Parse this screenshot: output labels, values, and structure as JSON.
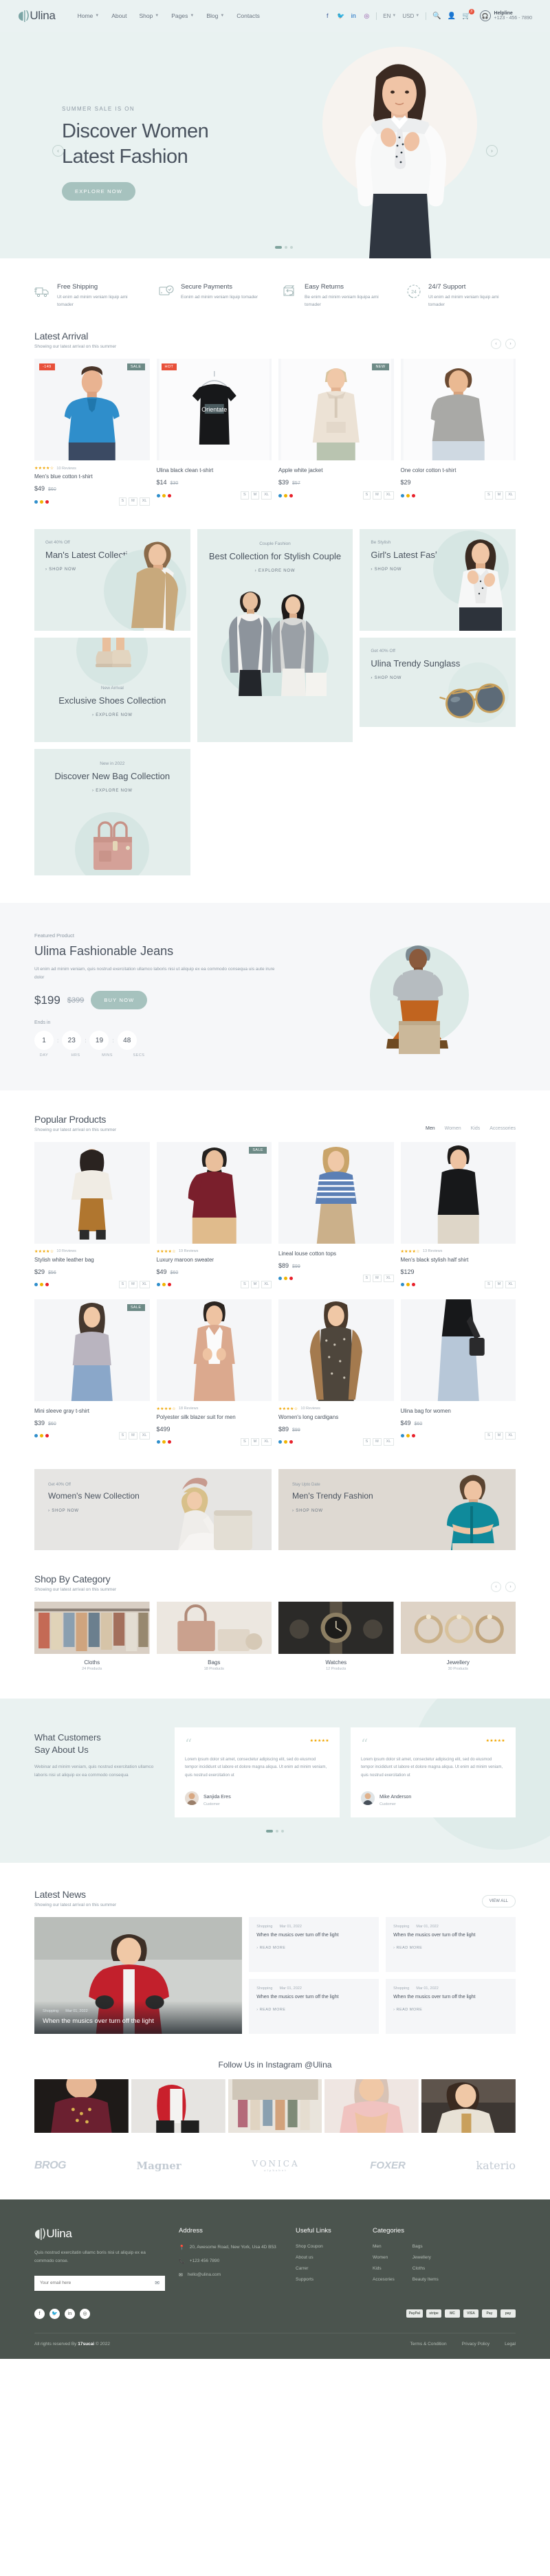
{
  "header": {
    "brand": "Ulina",
    "nav": [
      {
        "label": "Home",
        "caret": true
      },
      {
        "label": "About",
        "caret": false
      },
      {
        "label": "Shop",
        "caret": true
      },
      {
        "label": "Pages",
        "caret": true
      },
      {
        "label": "Blog",
        "caret": true
      },
      {
        "label": "Contacts",
        "caret": false
      }
    ],
    "social": [
      "facebook-icon",
      "twitter-icon",
      "linkedin-icon",
      "instagram-icon"
    ],
    "language": "EN",
    "currency": "USD",
    "cart_count": "3",
    "helpline_label": "Helpline",
    "helpline_number": "+123 - 456 - 7890"
  },
  "hero": {
    "kicker": "SUMMER SALE IS ON",
    "title_line1": "Discover Women",
    "title_line2": "Latest Fashion",
    "cta": "EXPLORE NOW",
    "prev": "‹",
    "next": "›"
  },
  "features": [
    {
      "icon": "truck-icon",
      "title": "Free Shipping",
      "desc": "Ut enim ad minim veniam liquip ami tomader"
    },
    {
      "icon": "shield-check-icon",
      "title": "Secure Payments",
      "desc": "Eonim ad minim veniam liquip tomader"
    },
    {
      "icon": "return-box-icon",
      "title": "Easy Returns",
      "desc": "Be enim ad minim veniam liquipa ami tomader"
    },
    {
      "icon": "support-24-icon",
      "title": "24/7 Support",
      "desc": "Ut enim ad minim veniam liquip ami tomader"
    }
  ],
  "latest_arrival": {
    "title": "Latest Arrival",
    "subtitle": "Showing our latest arrival on this summer",
    "products": [
      {
        "name": "Men's blue cotton t-shirt",
        "price": "$49",
        "old": "$60",
        "rating": "★★★★☆",
        "reviews": "10 Reviews",
        "badge_left": "-149",
        "badge_right": "SALE",
        "sizes": [
          "S",
          "M",
          "XL"
        ]
      },
      {
        "name": "Ulina black clean t-shirt",
        "price": "$14",
        "old": "$30",
        "rating": "",
        "reviews": "",
        "badge_left": "HOT",
        "badge_right": "",
        "sizes": [
          "S",
          "M",
          "XL"
        ]
      },
      {
        "name": "Apple white jacket",
        "price": "$39",
        "old": "$57",
        "rating": "",
        "reviews": "",
        "badge_left": "",
        "badge_right": "NEW",
        "sizes": [
          "S",
          "M",
          "XL"
        ]
      },
      {
        "name": "One color cotton t-shirt",
        "price": "$29",
        "old": "",
        "rating": "",
        "reviews": "",
        "badge_left": "",
        "badge_right": "",
        "sizes": [
          "S",
          "M",
          "XL"
        ]
      }
    ]
  },
  "mosaic": {
    "mans": {
      "kicker": "Get 40% Off",
      "title": "Man's Latest Collection",
      "link": "› SHOP NOW"
    },
    "couple": {
      "kicker": "Couple Fashion",
      "title": "Best Collection for Stylish Couple",
      "link": "› EXPLORE NOW"
    },
    "girls": {
      "kicker": "Be Stylish",
      "title": "Girl's Latest Fashion",
      "link": "› SHOP NOW"
    },
    "shoes": {
      "kicker": "New Arrival",
      "title": "Exclusive Shoes Collection",
      "link": "› EXPLORE NOW"
    },
    "sunglass": {
      "kicker": "Get 40% Off",
      "title": "Ulina Trendy Sunglass",
      "link": "› SHOP NOW"
    },
    "bag": {
      "kicker": "New in 2022",
      "title": "Discover New Bag Collection",
      "link": "› EXPLORE NOW"
    }
  },
  "deal": {
    "kicker": "Featured Product",
    "title": "Ulima Fashionable Jeans",
    "desc": "Ut enim ad minim veniam, quis nostrud exercitation ullamco laboris nisi ut aliquip ex ea commodo consequa uis aute irure dolor",
    "price": "$199",
    "old_price": "$399",
    "cta": "BUY NOW",
    "ends_label": "Ends in",
    "countdown": [
      {
        "value": "1",
        "label": "DAY"
      },
      {
        "value": "23",
        "label": "HRS"
      },
      {
        "value": "19",
        "label": "MINS"
      },
      {
        "value": "48",
        "label": "SECS"
      }
    ]
  },
  "popular": {
    "title": "Popular Products",
    "subtitle": "Showing our latest arrival on this summer",
    "tabs": [
      {
        "label": "Men",
        "active": true
      },
      {
        "label": "Women",
        "active": false
      },
      {
        "label": "Kids",
        "active": false
      },
      {
        "label": "Accessories",
        "active": false
      }
    ],
    "products": [
      {
        "name": "Stylish white leather bag",
        "price": "$29",
        "old": "$56",
        "rating": "★★★★☆",
        "reviews": "10 Reviews",
        "badge_left": "",
        "badge_right": "",
        "sizes": [
          "S",
          "M",
          "XL"
        ]
      },
      {
        "name": "Luxury maroon sweater",
        "price": "$49",
        "old": "$60",
        "rating": "★★★★☆",
        "reviews": "19 Reviews",
        "badge_left": "",
        "badge_right": "SALE",
        "sizes": [
          "S",
          "M",
          "XL"
        ]
      },
      {
        "name": "Lineal louse cotton tops",
        "price": "$89",
        "old": "$99",
        "rating": "",
        "reviews": "",
        "badge_left": "",
        "badge_right": "",
        "sizes": [
          "S",
          "M",
          "XL"
        ]
      },
      {
        "name": "Men's black stylish half shirt",
        "price": "$129",
        "old": "",
        "rating": "★★★★☆",
        "reviews": "13 Reviews",
        "badge_left": "",
        "badge_right": "",
        "sizes": [
          "S",
          "M",
          "XL"
        ]
      },
      {
        "name": "Mini sleeve gray t-shirt",
        "price": "$39",
        "old": "$60",
        "rating": "",
        "reviews": "",
        "badge_left": "",
        "badge_right": "SALE",
        "sizes": [
          "S",
          "M",
          "XL"
        ]
      },
      {
        "name": "Polyester silk blazer suit for men",
        "price": "$499",
        "old": "",
        "rating": "★★★★☆",
        "reviews": "18 Reviews",
        "badge_left": "",
        "badge_right": "",
        "sizes": [
          "S",
          "M",
          "XL"
        ]
      },
      {
        "name": "Women's long cardigans",
        "price": "$89",
        "old": "$99",
        "rating": "★★★★☆",
        "reviews": "10 Reviews",
        "badge_left": "",
        "badge_right": "",
        "sizes": [
          "S",
          "M",
          "XL"
        ]
      },
      {
        "name": "Ulina bag for women",
        "price": "$49",
        "old": "$60",
        "rating": "",
        "reviews": "",
        "badge_left": "",
        "badge_right": "",
        "sizes": [
          "S",
          "M",
          "XL"
        ]
      }
    ]
  },
  "dual_banner": {
    "women": {
      "kicker": "Get 40% Off",
      "title": "Women's New Collection",
      "link": "› SHOP NOW"
    },
    "men": {
      "kicker": "Stay Upto Date",
      "title": "Men's Trendy Fashion",
      "link": "› SHOP NOW"
    }
  },
  "categories": {
    "title": "Shop By Category",
    "subtitle": "Showing our latest arrival on this summer",
    "items": [
      {
        "name": "Cloths",
        "count": "24 Products"
      },
      {
        "name": "Bags",
        "count": "18 Products"
      },
      {
        "name": "Watches",
        "count": "12 Products"
      },
      {
        "name": "Jewellery",
        "count": "30 Products"
      }
    ]
  },
  "testimonials": {
    "title_line1": "What Customers",
    "title_line2": "Say About Us",
    "desc": "Webinar ad minim veniam, quis nostrud exercitation ullamco laboris nisi ut aliquip ex ea commodo consequa",
    "cards": [
      {
        "stars": "★★★★★",
        "text": "Lorem ipsum dolor sit amet, consectetur adipiscing elit, sed do eiusmod tempor incididunt ut labore et dolore magna aliqua. Ut enim ad minim veniam, quis nostrud exercitation ut",
        "name": "Sanjida Eres",
        "role": "Customer"
      },
      {
        "stars": "★★★★★",
        "text": "Lorem ipsum dolor sit amet, consectetur adipiscing elit, sed do eiusmod tempor incididunt ut labore et dolore magna aliqua. Ut enim ad minim veniam, quis nostrud exercitation ut",
        "name": "Mike Anderson",
        "role": "Customer"
      }
    ]
  },
  "news": {
    "title": "Latest News",
    "subtitle": "Showing our latest arrival on this summer",
    "view_all": "VIEW ALL",
    "featured": {
      "category": "Shopping",
      "date": "Mar 01, 2022",
      "title": "When the musics over turn off the light"
    },
    "items": [
      {
        "category": "Shopping",
        "date": "Mar 01, 2022",
        "title": "When the musics over turn off the light",
        "link": "› READ MORE"
      },
      {
        "category": "Shopping",
        "date": "Mar 01, 2022",
        "title": "When the musics over turn off the light",
        "link": "› READ MORE"
      },
      {
        "category": "Shopping",
        "date": "Mar 01, 2022",
        "title": "When the musics over turn off the light",
        "link": "› READ MORE"
      },
      {
        "category": "Shopping",
        "date": "Mar 01, 2022",
        "title": "When the musics over turn off the light",
        "link": "› READ MORE"
      }
    ]
  },
  "instagram": {
    "title": "Follow Us in Instagram @Ulina"
  },
  "brands": [
    {
      "name": "BROG"
    },
    {
      "name": "Magner"
    },
    {
      "name": "VONICA",
      "sub": "alphabet"
    },
    {
      "name": "FOXER"
    },
    {
      "name": "katerio"
    }
  ],
  "footer": {
    "brand": "Ulina",
    "about": "Quis nostrud exercitatin ullamc boris nisi ut aliquip ex ea commodo conse.",
    "email_placeholder": "Your email here",
    "address_title": "Address",
    "address_line": "20, Awesome Road, New York, Usa 4D B53",
    "phone": "+123 456 7890",
    "email": "hello@ulina.com",
    "useful_title": "Useful Links",
    "useful": [
      "Shop Coupon",
      "About us",
      "Carrer",
      "Supports"
    ],
    "cats_title": "Categories",
    "cats_col1": [
      "Men",
      "Women",
      "Kids",
      "Accesories"
    ],
    "cats_col2": [
      "Bags",
      "Jewellery",
      "Cloths",
      "Beauty Items"
    ],
    "payments": [
      "PayPal",
      "stripe",
      "MC",
      "VISA",
      "Pay",
      "pay"
    ],
    "copyright_pre": "All rights reserved  By",
    "copyright_brand": "17sucai",
    "copyright_post": "©  2022",
    "bottom_links": [
      "Terms & Condition",
      "Privacy Policy",
      "Legal"
    ]
  }
}
